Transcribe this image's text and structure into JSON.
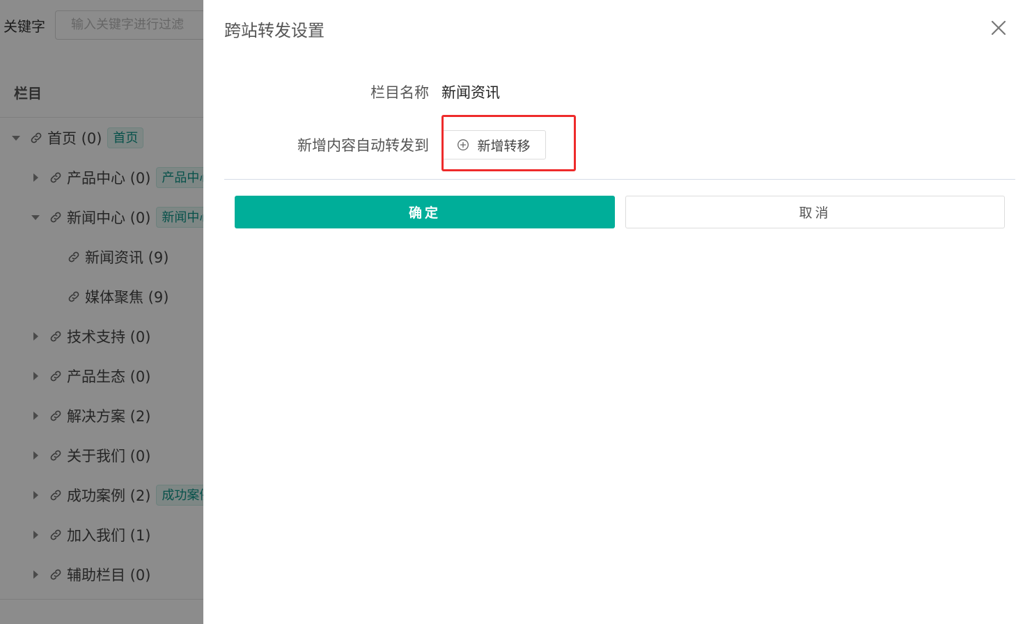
{
  "filter": {
    "label": "关键字",
    "placeholder": "输入关键字进行过滤"
  },
  "tree": {
    "header": "栏目",
    "nodes": [
      {
        "label": "首页 (0)",
        "tag": "首页",
        "expanded": true
      },
      {
        "label": "产品中心 (0)",
        "tag": "产品中心",
        "expanded": false
      },
      {
        "label": "新闻中心 (0)",
        "tag": "新闻中心",
        "expanded": true
      },
      {
        "label": "新闻资讯 (9)",
        "tag": "",
        "leaf": true
      },
      {
        "label": "媒体聚焦 (9)",
        "tag": "",
        "leaf": true
      },
      {
        "label": "技术支持 (0)",
        "tag": "",
        "expanded": false
      },
      {
        "label": "产品生态 (0)",
        "tag": "",
        "expanded": false
      },
      {
        "label": "解决方案 (2)",
        "tag": "",
        "expanded": false
      },
      {
        "label": "关于我们 (0)",
        "tag": "",
        "expanded": false
      },
      {
        "label": "成功案例 (2)",
        "tag": "成功案例",
        "expanded": false
      },
      {
        "label": "加入我们 (1)",
        "tag": "",
        "expanded": false
      },
      {
        "label": "辅助栏目 (0)",
        "tag": "",
        "expanded": false
      }
    ]
  },
  "drawer": {
    "title": "跨站转发设置",
    "column_name_label": "栏目名称",
    "column_name_value": "新闻资讯",
    "auto_forward_label": "新增内容自动转发到",
    "add_transfer_label": "新增转移",
    "confirm_label": "确定",
    "cancel_label": "取消"
  },
  "colors": {
    "primary": "#00ae99",
    "highlight": "#ee2b2b",
    "mask": "rgba(0,0,0,0.45)"
  }
}
